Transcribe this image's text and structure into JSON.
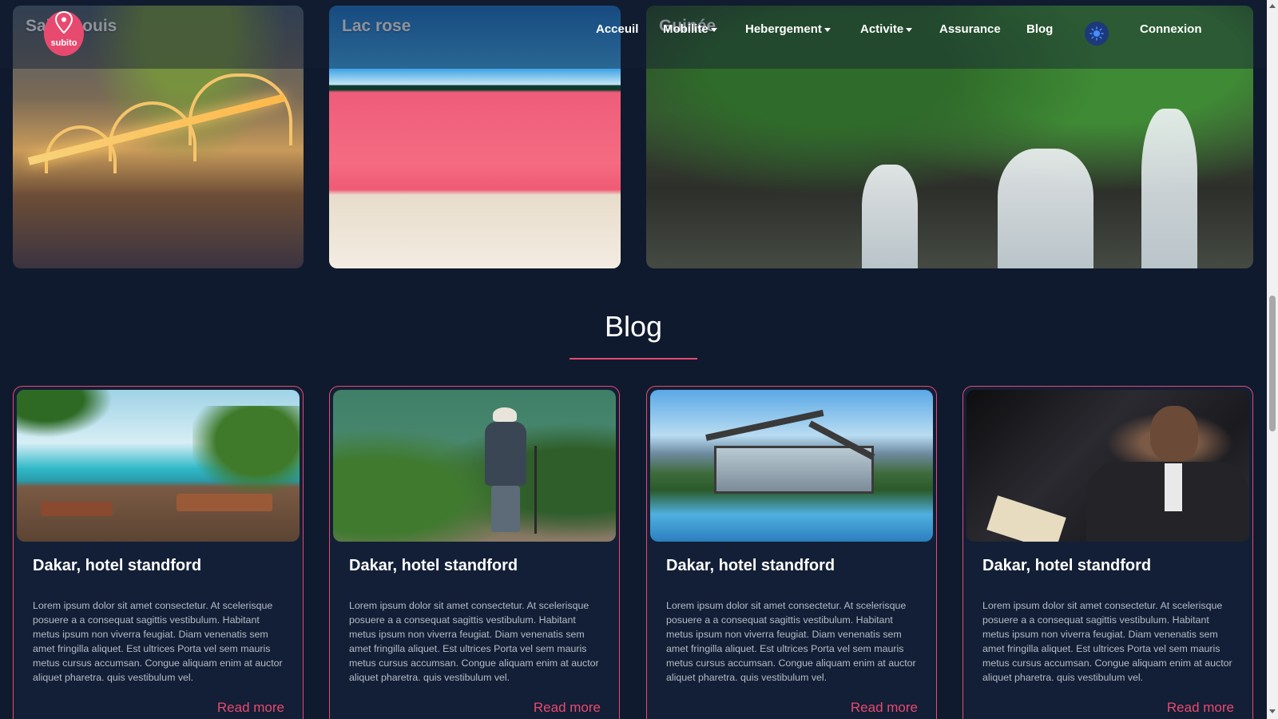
{
  "destinations": [
    {
      "title": "Saint-Louis"
    },
    {
      "title": "Lac rose"
    },
    {
      "title": "Guinée"
    }
  ],
  "navbar": {
    "logo_text": "subito",
    "links": {
      "acceuil": "Acceuil",
      "mobilite": "Mobilite",
      "hebergement": "Hebergement",
      "activite": "Activite",
      "assurance": "Assurance",
      "blog": "Blog",
      "connexion": "Connexion"
    }
  },
  "blog": {
    "heading": "Blog",
    "cards": [
      {
        "title": "Dakar, hotel standford",
        "text": "Lorem ipsum dolor sit amet consectetur. At scelerisque posuere a a consequat sagittis vestibulum. Habitant metus ipsum non viverra feugiat. Diam venenatis sem amet fringilla aliquet. Est ultrices Porta vel sem mauris metus cursus accumsan. Congue aliquam enim at auctor aliquet pharetra. quis vestibulum vel.",
        "link": "Read more"
      },
      {
        "title": "Dakar, hotel standford",
        "text": "Lorem ipsum dolor sit amet consectetur. At scelerisque posuere a a consequat sagittis vestibulum. Habitant metus ipsum non viverra feugiat. Diam venenatis sem amet fringilla aliquet. Est ultrices Porta vel sem mauris metus cursus accumsan. Congue aliquam enim at auctor aliquet pharetra. quis vestibulum vel.",
        "link": "Read more"
      },
      {
        "title": "Dakar, hotel standford",
        "text": "Lorem ipsum dolor sit amet consectetur. At scelerisque posuere a a consequat sagittis vestibulum. Habitant metus ipsum non viverra feugiat. Diam venenatis sem amet fringilla aliquet. Est ultrices Porta vel sem mauris metus cursus accumsan. Congue aliquam enim at auctor aliquet pharetra. quis vestibulum vel.",
        "link": "Read more"
      },
      {
        "title": "Dakar, hotel standford",
        "text": "Lorem ipsum dolor sit amet consectetur. At scelerisque posuere a a consequat sagittis vestibulum. Habitant metus ipsum non viverra feugiat. Diam venenatis sem amet fringilla aliquet. Est ultrices Porta vel sem mauris metus cursus accumsan. Congue aliquam enim at auctor aliquet pharetra. quis vestibulum vel.",
        "link": "Read more"
      }
    ]
  },
  "colors": {
    "background": "#0f1a2e",
    "accent": "#e84a6f",
    "card_background": "#131f36"
  },
  "icons": {
    "logo": "location-pin-icon",
    "theme_toggle": "sun-icon"
  }
}
